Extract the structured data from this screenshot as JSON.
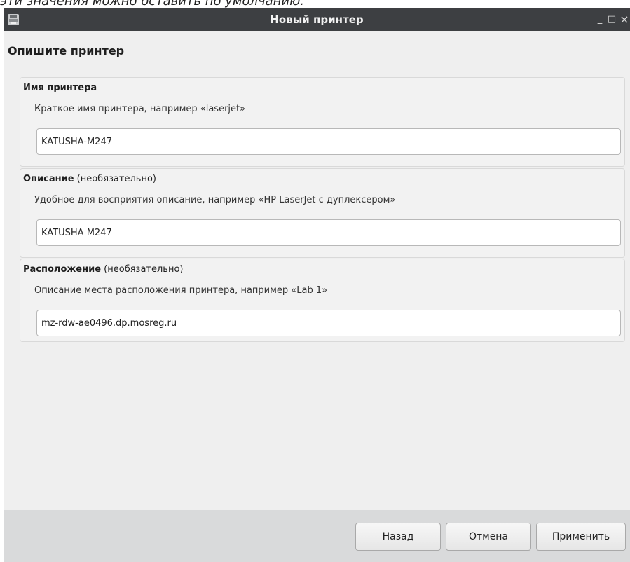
{
  "caption": "эти значения можно оставить по умолчанию.",
  "window": {
    "title": "Новый принтер",
    "icon": "printer-icon",
    "controls": {
      "minimize": "_",
      "maximize": "□",
      "close": "×"
    }
  },
  "page": {
    "heading": "Опишите принтер"
  },
  "groups": {
    "name": {
      "title": "Имя принтера",
      "optional": "",
      "hint": "Краткое имя принтера, например «laserjet»",
      "value": "KATUSHA-M247"
    },
    "description": {
      "title": "Описание",
      "optional": " (необязательно)",
      "hint": "Удобное для восприятия описание, например «HP LaserJet с дуплексером»",
      "value": "KATUSHA M247"
    },
    "location": {
      "title": "Расположение",
      "optional": " (необязательно)",
      "hint": "Описание места расположения принтера, например «Lab 1»",
      "value": "mz-rdw-ae0496.dp.mosreg.ru"
    }
  },
  "buttons": {
    "back": "Назад",
    "cancel": "Отмена",
    "apply": "Применить"
  }
}
